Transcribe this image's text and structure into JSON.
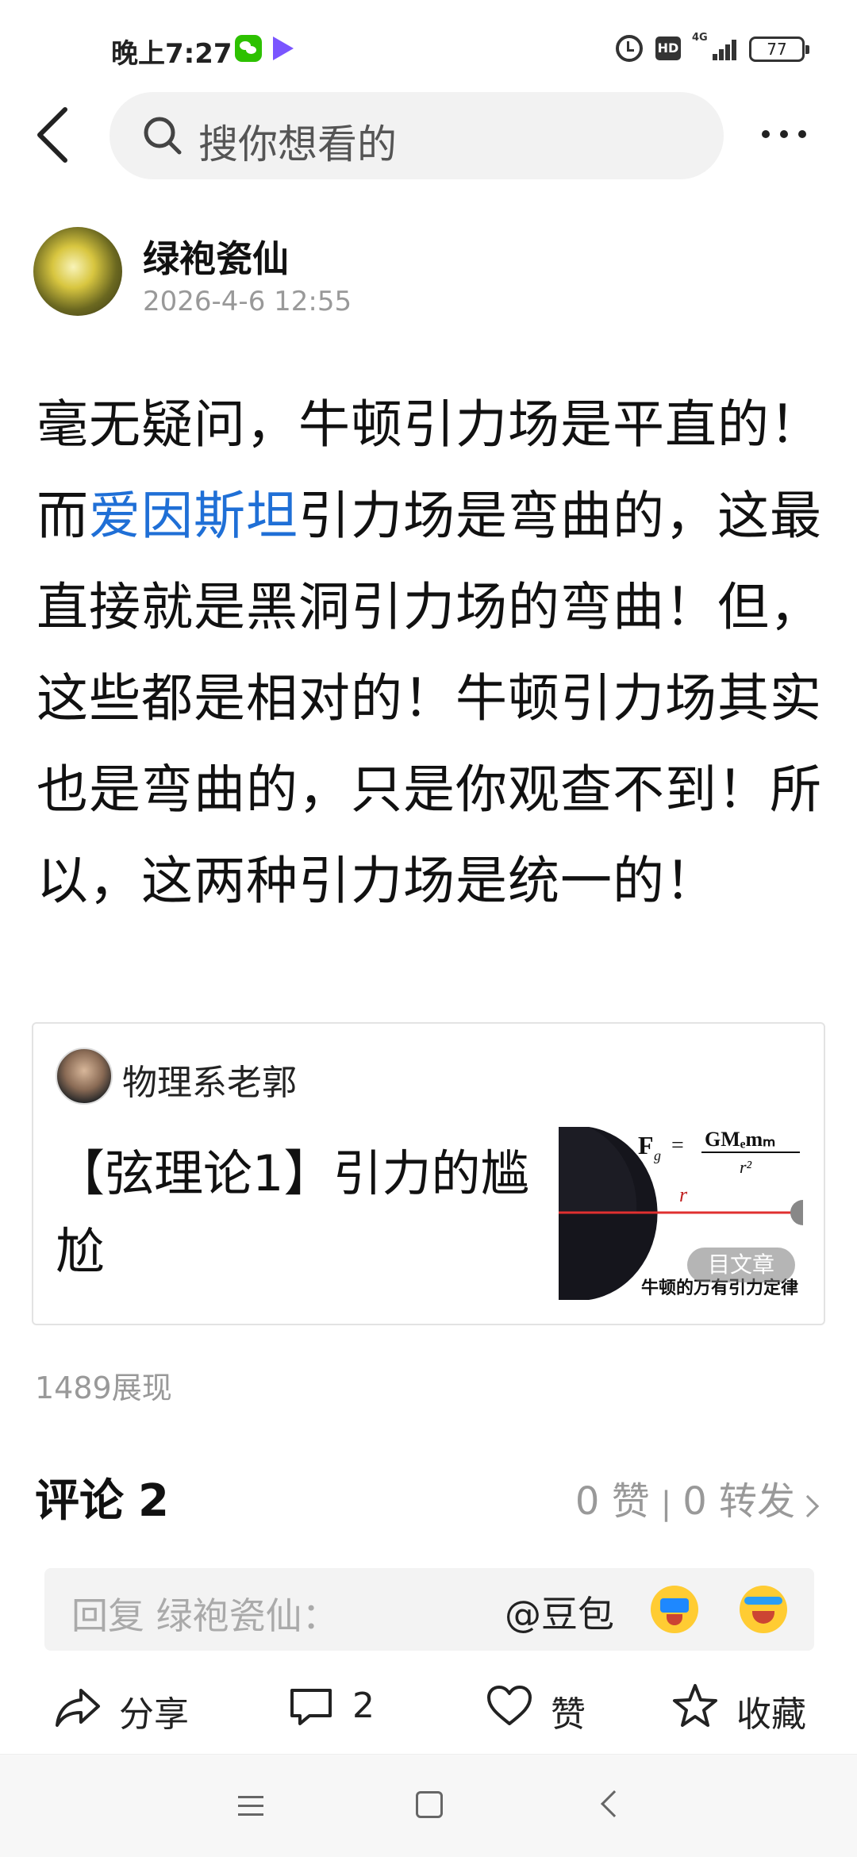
{
  "status_bar": {
    "time": "晚上7:27",
    "network_label": "4G",
    "hd_label": "HD",
    "battery": "77"
  },
  "header": {
    "search_placeholder": "搜你想看的"
  },
  "post": {
    "author": "绿袍瓷仙",
    "time": "2026-4-6 12:55",
    "text_before_link": "毫无疑问，牛顿引力场是平直的！而",
    "link_text": "爱因斯坦",
    "text_after_link": "引力场是弯曲的，这最直接就是黑洞引力场的弯曲！但，这些都是相对的！牛顿引力场其实也是弯曲的，只是你观查不到！所以，这两种引力场是统一的！",
    "link_color": "#1f6fd6",
    "views": "1489展现"
  },
  "shared_article": {
    "author": "物理系老郭",
    "title": "【弦理论1】引力的尴尬",
    "thumb_formula_lhs": "F",
    "thumb_formula_sub": "g",
    "thumb_formula_rhs": "GMₑmₘ",
    "thumb_formula_den": "r²",
    "thumb_r_label": "r",
    "thumb_caption": "牛顿的万有引力定律",
    "thumb_badge": "目文章"
  },
  "comments": {
    "title": "评论",
    "count": "2",
    "likes": "0 赞",
    "separator": "|",
    "reposts": "0 转发"
  },
  "reply": {
    "placeholder": "回复 绿袍瓷仙：",
    "mention": "@豆包"
  },
  "actions": {
    "share": "分享",
    "comment_count": "2",
    "like": "赞",
    "collect": "收藏"
  },
  "icons": {
    "back": "back-arrow-icon",
    "search": "search-icon",
    "more": "more-dots-icon",
    "share": "share-icon",
    "comment": "comment-icon",
    "like": "heart-icon",
    "collect": "star-icon"
  }
}
